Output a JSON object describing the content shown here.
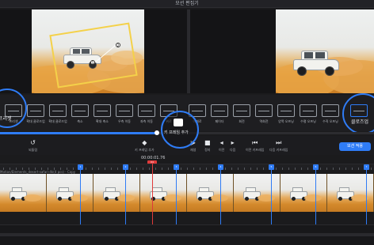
{
  "window": {
    "title": "모션 편집기"
  },
  "toolbar": {
    "items": [
      {
        "label": "프리셋",
        "icon": "camera-icon"
      },
      {
        "label": "확대 클로즈업",
        "icon": "zoom-in-icon"
      },
      {
        "label": "확대 클로즈업",
        "icon": "zoom-out-icon"
      },
      {
        "label": "축소",
        "icon": "shrink-icon"
      },
      {
        "label": "확대 축소",
        "icon": "zoom-icon"
      },
      {
        "label": "우측 이동",
        "icon": "pan-right-icon"
      },
      {
        "label": "좌측 이동",
        "icon": "pan-left-icon"
      },
      {
        "label": "위로",
        "icon": "pan-up-icon"
      },
      {
        "label": "아래로",
        "icon": "pan-down-icon"
      },
      {
        "label": "줌인",
        "icon": "zoom-in-frame-icon"
      },
      {
        "label": "어웨이",
        "icon": "away-icon"
      },
      {
        "label": "페이더",
        "icon": "fader-icon"
      },
      {
        "label": "회전",
        "icon": "rotate-icon"
      },
      {
        "label": "역회전",
        "icon": "rotate-reverse-icon"
      },
      {
        "label": "양쪽 오프닝",
        "icon": "open-icon"
      },
      {
        "label": "수평 오프닝",
        "icon": "h-open-icon"
      },
      {
        "label": "수직 오프닝",
        "icon": "v-open-icon"
      },
      {
        "label": "클로즈업",
        "icon": "closeup-icon"
      }
    ],
    "preset_label": "프리셋",
    "closeup_label": "클로즈업"
  },
  "progress": {
    "value": 0.42
  },
  "controls": {
    "reset": "되돌림",
    "add_keyframe": "키 프레임 추가",
    "add_keyframe_hl": "키 프레임 추가",
    "delete_keyframe": "키 프레임 삭제",
    "play": "재생",
    "stop": "정지",
    "prev": "이전",
    "next": "다음",
    "prev_keyframe": "이전 키프레임",
    "next_keyframe": "다음 키프레임",
    "apply": "모션 적용"
  },
  "timeline": {
    "timecode": "00:00:01.76",
    "badge": "04",
    "clip_name": "Motion/Elements_desert-safari-4k(4 pcs) - Copy",
    "keyframes": [
      1,
      2,
      3,
      4,
      5,
      6,
      7,
      8
    ]
  },
  "colors": {
    "accent": "#2f7cf6",
    "playhead": "#e03a3a",
    "keyframe_box": "#f4d149"
  }
}
